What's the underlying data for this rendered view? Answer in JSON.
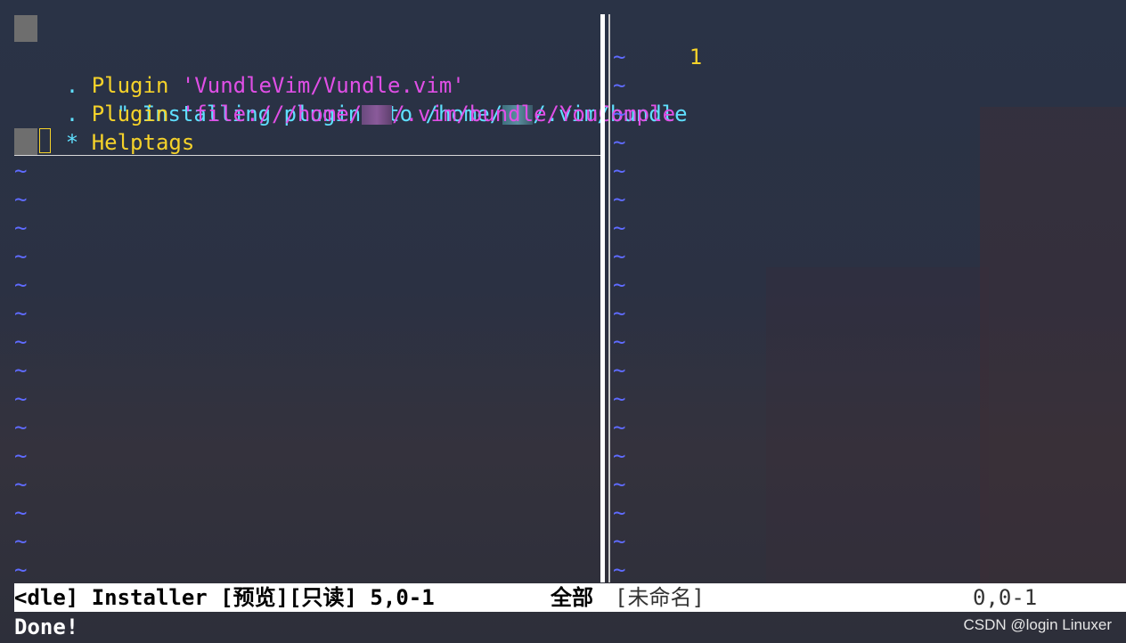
{
  "left_pane": {
    "line1_quote": "\"",
    "line1_text": " Installing plugins to /home/",
    "line1_tail": "/.vim/bundle",
    "line2_marker": ".",
    "line2_keyword": " Plugin ",
    "line2_value": "'VundleVim/Vundle.vim'",
    "line3_marker": ".",
    "line3_keyword": " Plugin ",
    "line3_value_head": "'file:///home/",
    "line3_value_tail": "/.vim/bundle/YouComple",
    "line4_marker": "*",
    "line4_keyword": " Helptags",
    "tilde": "~"
  },
  "right_pane": {
    "line_number": "1",
    "tilde": "~"
  },
  "status_bar": {
    "left_file": "<dle] Installer [预览][只读] 5,0-1",
    "left_scroll": "全部",
    "right_file": "[未命名]",
    "right_pos": "0,0-1"
  },
  "command_line": {
    "message": "Done!"
  },
  "watermark": {
    "text": "CSDN @login Linuxer"
  },
  "colors": {
    "cyan": "#5fe0ff",
    "yellow": "#f5d22a",
    "magenta": "#e04fe6",
    "tilde_blue": "#5f6bff"
  }
}
